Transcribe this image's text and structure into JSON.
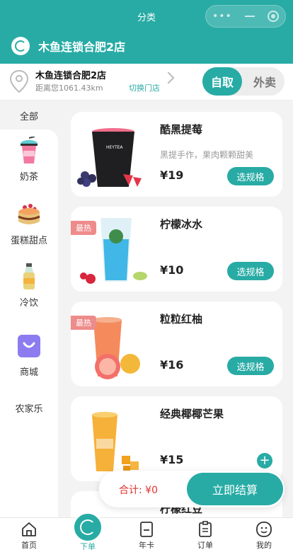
{
  "nav": {
    "title": "分类"
  },
  "brand": {
    "name": "木鱼连锁合肥2店"
  },
  "store": {
    "name": "木鱼连锁合肥2店",
    "distance": "距离您1061.43km",
    "switch_label": "切换门店"
  },
  "mode": {
    "pickup": "自取",
    "delivery": "外卖",
    "selected": "自取"
  },
  "categories": {
    "all": "全部",
    "items": [
      {
        "label": "奶茶",
        "icon": "milk-tea-icon"
      },
      {
        "label": "蛋糕甜点",
        "icon": "cake-icon"
      },
      {
        "label": "冷饮",
        "icon": "cold-drink-icon"
      },
      {
        "label": "商城",
        "icon": "shopping-bag-icon"
      },
      {
        "label": "农家乐"
      }
    ]
  },
  "products": [
    {
      "name": "酷黑提莓",
      "desc": "黑提手作，果肉颗颗甜美",
      "price": "¥19",
      "action": "选规格"
    },
    {
      "name": "柠檬冰水",
      "tag": "最热",
      "price": "¥10",
      "action": "选规格"
    },
    {
      "name": "粒粒红柚",
      "tag": "最热",
      "price": "¥16",
      "action": "选规格"
    },
    {
      "name": "经典椰椰芒果",
      "price": "¥15",
      "action": "+"
    },
    {
      "name": "柠檬红豆"
    }
  ],
  "cart": {
    "total_label": "合计: ¥0",
    "checkout_label": "立即结算"
  },
  "tabs": [
    {
      "label": "首页",
      "icon": "home-icon"
    },
    {
      "label": "下单",
      "icon": "order-now-icon"
    },
    {
      "label": "年卡",
      "icon": "card-icon"
    },
    {
      "label": "订单",
      "icon": "orders-icon"
    },
    {
      "label": "我的",
      "icon": "profile-icon"
    }
  ],
  "colors": {
    "accent": "#28aba5",
    "hot": "#ee8b8b",
    "total": "#e03030"
  }
}
